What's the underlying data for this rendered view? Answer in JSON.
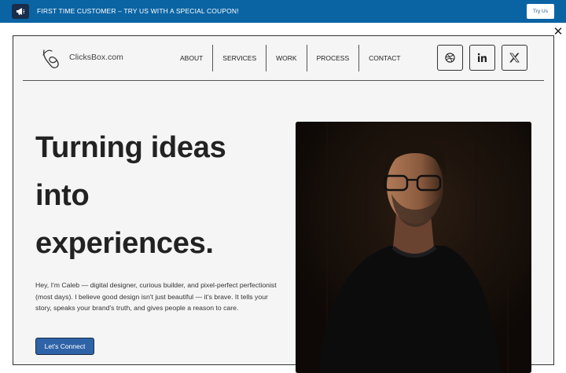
{
  "banner": {
    "text": "FIRST TIME CUSTOMER – TRY US WITH A SPECIAL COUPON!",
    "button_label": "Try Us",
    "icon": "megaphone-icon",
    "background": "#0a64a4"
  },
  "close_icon": "close-icon",
  "header": {
    "brand": "ClicksBox.com",
    "nav": [
      "ABOUT",
      "SERVICES",
      "WORK",
      "PROCESS",
      "CONTACT"
    ],
    "socials": [
      "dribbble-icon",
      "linkedin-icon",
      "x-icon"
    ]
  },
  "hero": {
    "title_lines": [
      "Turning ideas",
      "into",
      "experiences."
    ],
    "description": "Hey, I'm Caleb — digital designer, curious builder, and pixel-perfect perfectionist (most days). I believe good design isn't just beautiful — it's brave. It tells your story, speaks your brand's truth, and gives people a reason to care.",
    "cta_label": "Let's Connect",
    "cta_color": "#2f63a8"
  }
}
